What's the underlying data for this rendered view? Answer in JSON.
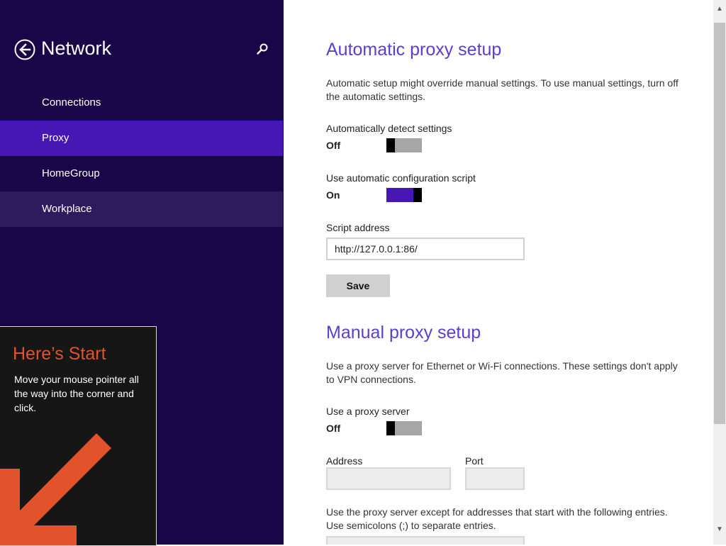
{
  "sidebar": {
    "title": "Network",
    "back_icon": "back-arrow-icon",
    "search_icon": "search-icon",
    "items": [
      {
        "label": "Connections"
      },
      {
        "label": "Proxy"
      },
      {
        "label": "HomeGroup"
      },
      {
        "label": "Workplace"
      }
    ],
    "active_index": 1,
    "colors": {
      "background": "#180648",
      "active": "#4617b4",
      "hover": "#2e1b5e"
    }
  },
  "start_tip": {
    "title": "Here’s Start",
    "body": "Move your mouse pointer all the way into the corner and click.",
    "arrow_icon": "corner-arrow-icon",
    "colors": {
      "title": "#e2532c",
      "arrow": "#e2532c",
      "background": "#161616"
    }
  },
  "automatic": {
    "title": "Automatic proxy setup",
    "description": "Automatic setup might override manual settings. To use manual settings, turn off the automatic settings.",
    "detect": {
      "label": "Automatically detect settings",
      "state": "Off"
    },
    "script": {
      "label": "Use automatic configuration script",
      "state": "On"
    },
    "script_address": {
      "label": "Script address",
      "value": "http://127.0.0.1:86/"
    },
    "save_label": "Save"
  },
  "manual": {
    "title": "Manual proxy setup",
    "description": "Use a proxy server for Ethernet or Wi-Fi connections. These settings don't apply to VPN connections.",
    "use_proxy": {
      "label": "Use a proxy server",
      "state": "Off"
    },
    "address": {
      "label": "Address",
      "value": ""
    },
    "port": {
      "label": "Port",
      "value": ""
    },
    "exceptions_description": "Use the proxy server except for addresses that start with the following entries. Use semicolons (;) to separate entries."
  },
  "accent_color": "#5a3fcf",
  "toggle_on_color": "#4617b4"
}
